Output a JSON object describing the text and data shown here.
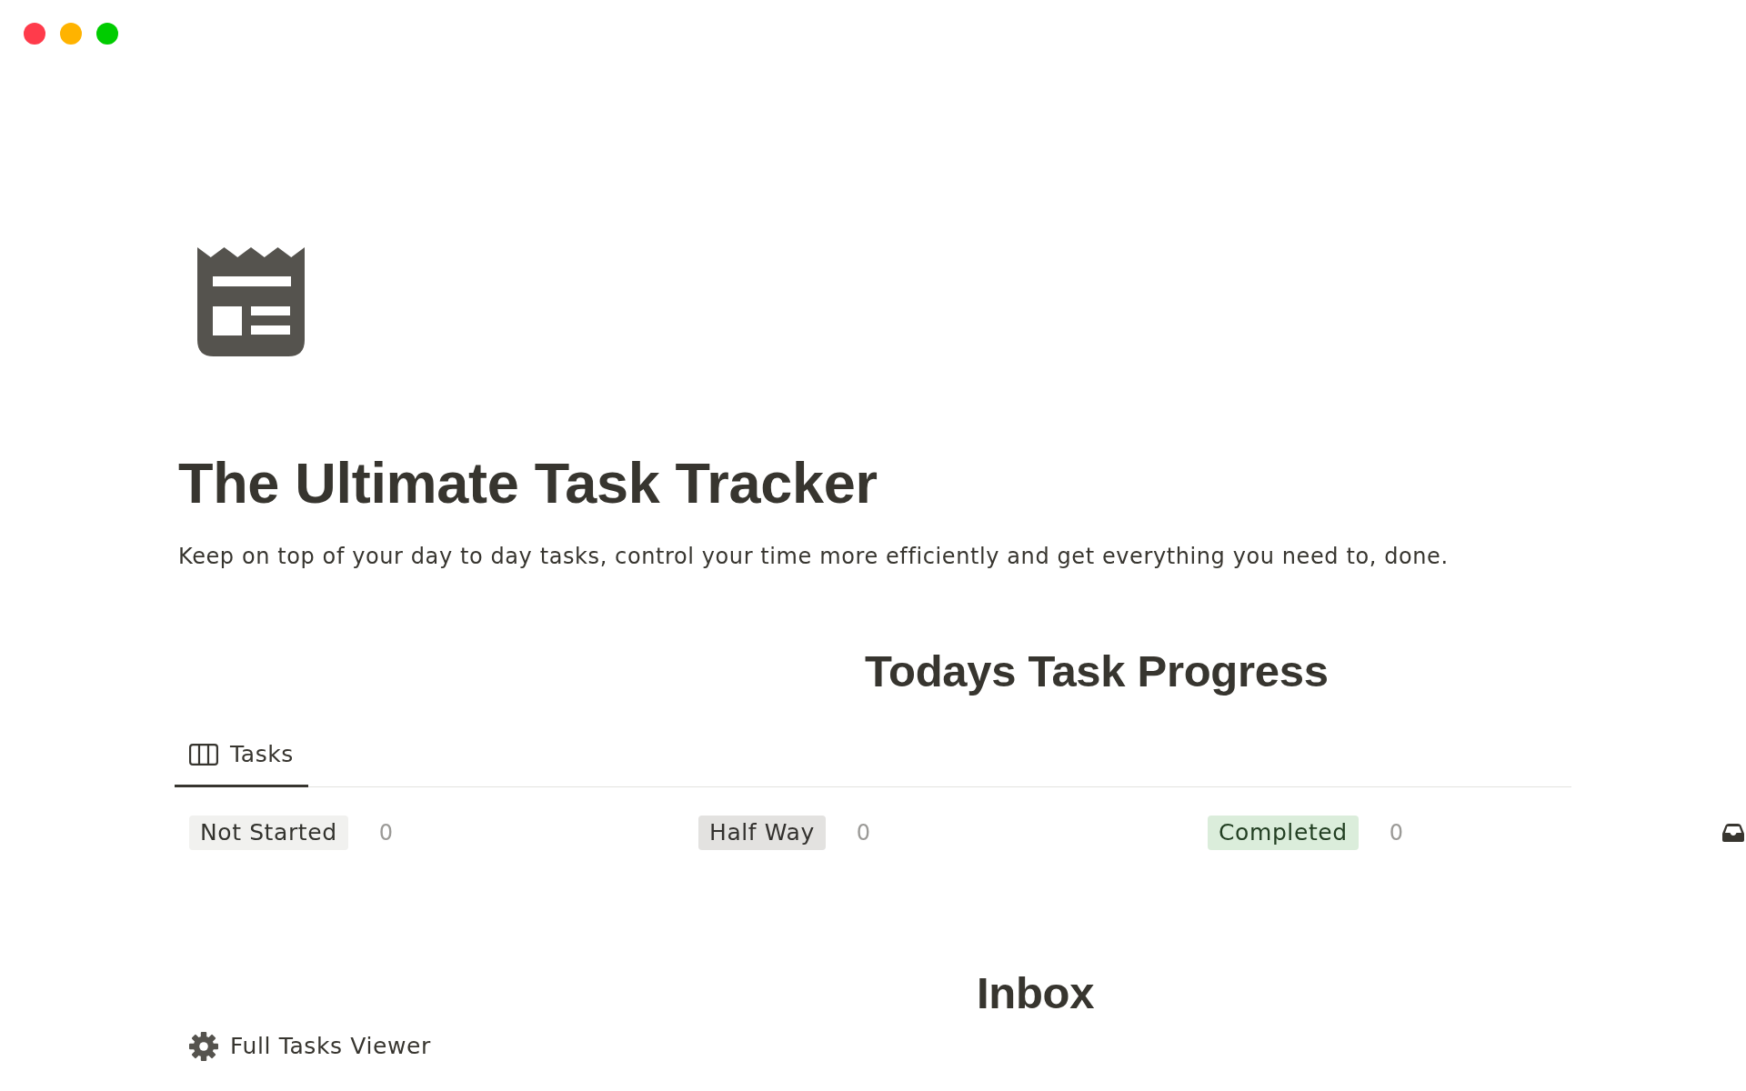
{
  "window": {
    "controls": [
      {
        "color": "#ff3b4b"
      },
      {
        "color": "#ffb300"
      },
      {
        "color": "#00cc00"
      }
    ]
  },
  "page": {
    "title": "The Ultimate Task Tracker",
    "description": "Keep on top of your day to day tasks, control your time more efficiently and get everything you need to, done."
  },
  "sections": [
    {
      "heading": "Todays Task Progress",
      "views": [
        {
          "label": "Tasks",
          "selected": true
        }
      ],
      "board": {
        "groups": [
          {
            "label": "Not Started",
            "count": "0",
            "color": "#f1f1ef"
          },
          {
            "label": "Half Way",
            "count": "0",
            "color": "#e3e2e0"
          },
          {
            "label": "Completed",
            "count": "0",
            "color": "#dbeddb"
          }
        ]
      }
    },
    {
      "heading": "Inbox",
      "views": [
        {
          "label": "Full Tasks Viewer"
        }
      ]
    }
  ]
}
